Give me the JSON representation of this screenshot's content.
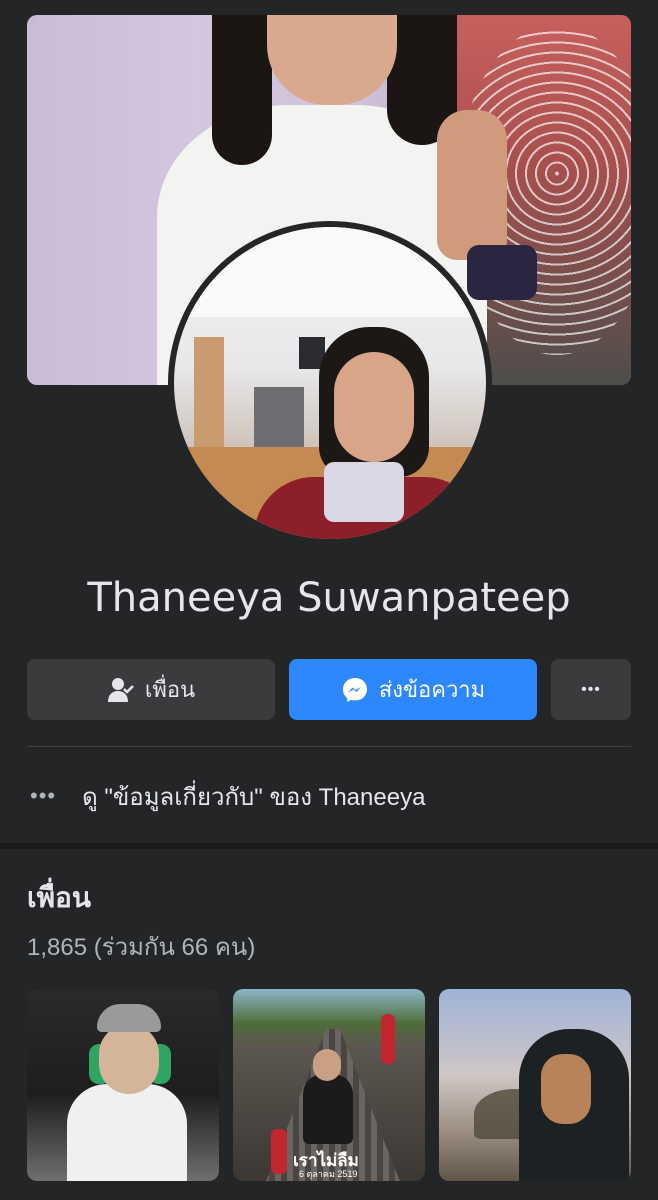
{
  "profile": {
    "name": "Thaneeya Suwanpateep"
  },
  "actions": {
    "friends_label": "เพื่อน",
    "message_label": "ส่งข้อความ",
    "more_label": "•••"
  },
  "about": {
    "dots": "•••",
    "text": "ดู \"ข้อมูลเกี่ยวกับ\" ของ Thaneeya"
  },
  "friends": {
    "title": "เพื่อน",
    "count": "1,865 (ร่วมกัน 66 คน)",
    "cards": [
      {
        "image": "friend-photo-1"
      },
      {
        "image": "friend-photo-2",
        "overlay_title": "เราไม่ลืม",
        "overlay_sub": "6 ตุลาคม 2519"
      },
      {
        "image": "friend-photo-3"
      }
    ]
  },
  "colors": {
    "background": "#242526",
    "button_primary": "#2d88ff",
    "button_secondary": "#3a3b3c",
    "text_primary": "#e4e6eb",
    "text_secondary": "#b0b3b8"
  },
  "icons": {
    "friends_button": "person-check-icon",
    "message_button": "messenger-icon",
    "more_button": "more-dots-icon",
    "about_row": "more-dots-icon"
  }
}
